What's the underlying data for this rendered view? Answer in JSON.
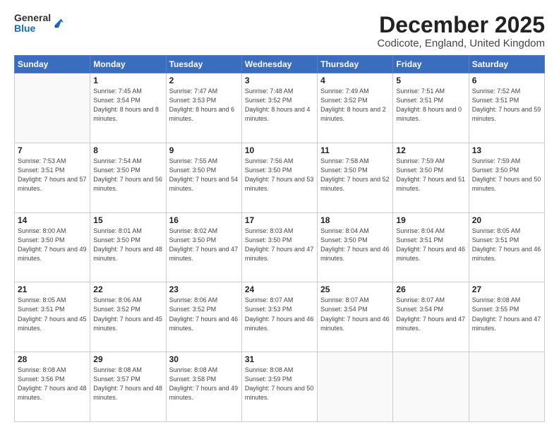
{
  "logo": {
    "general": "General",
    "blue": "Blue"
  },
  "title": "December 2025",
  "subtitle": "Codicote, England, United Kingdom",
  "days_header": [
    "Sunday",
    "Monday",
    "Tuesday",
    "Wednesday",
    "Thursday",
    "Friday",
    "Saturday"
  ],
  "weeks": [
    [
      {
        "day": "",
        "sunrise": "",
        "sunset": "",
        "daylight": ""
      },
      {
        "day": "1",
        "sunrise": "Sunrise: 7:45 AM",
        "sunset": "Sunset: 3:54 PM",
        "daylight": "Daylight: 8 hours and 8 minutes."
      },
      {
        "day": "2",
        "sunrise": "Sunrise: 7:47 AM",
        "sunset": "Sunset: 3:53 PM",
        "daylight": "Daylight: 8 hours and 6 minutes."
      },
      {
        "day": "3",
        "sunrise": "Sunrise: 7:48 AM",
        "sunset": "Sunset: 3:52 PM",
        "daylight": "Daylight: 8 hours and 4 minutes."
      },
      {
        "day": "4",
        "sunrise": "Sunrise: 7:49 AM",
        "sunset": "Sunset: 3:52 PM",
        "daylight": "Daylight: 8 hours and 2 minutes."
      },
      {
        "day": "5",
        "sunrise": "Sunrise: 7:51 AM",
        "sunset": "Sunset: 3:51 PM",
        "daylight": "Daylight: 8 hours and 0 minutes."
      },
      {
        "day": "6",
        "sunrise": "Sunrise: 7:52 AM",
        "sunset": "Sunset: 3:51 PM",
        "daylight": "Daylight: 7 hours and 59 minutes."
      }
    ],
    [
      {
        "day": "7",
        "sunrise": "Sunrise: 7:53 AM",
        "sunset": "Sunset: 3:51 PM",
        "daylight": "Daylight: 7 hours and 57 minutes."
      },
      {
        "day": "8",
        "sunrise": "Sunrise: 7:54 AM",
        "sunset": "Sunset: 3:50 PM",
        "daylight": "Daylight: 7 hours and 56 minutes."
      },
      {
        "day": "9",
        "sunrise": "Sunrise: 7:55 AM",
        "sunset": "Sunset: 3:50 PM",
        "daylight": "Daylight: 7 hours and 54 minutes."
      },
      {
        "day": "10",
        "sunrise": "Sunrise: 7:56 AM",
        "sunset": "Sunset: 3:50 PM",
        "daylight": "Daylight: 7 hours and 53 minutes."
      },
      {
        "day": "11",
        "sunrise": "Sunrise: 7:58 AM",
        "sunset": "Sunset: 3:50 PM",
        "daylight": "Daylight: 7 hours and 52 minutes."
      },
      {
        "day": "12",
        "sunrise": "Sunrise: 7:59 AM",
        "sunset": "Sunset: 3:50 PM",
        "daylight": "Daylight: 7 hours and 51 minutes."
      },
      {
        "day": "13",
        "sunrise": "Sunrise: 7:59 AM",
        "sunset": "Sunset: 3:50 PM",
        "daylight": "Daylight: 7 hours and 50 minutes."
      }
    ],
    [
      {
        "day": "14",
        "sunrise": "Sunrise: 8:00 AM",
        "sunset": "Sunset: 3:50 PM",
        "daylight": "Daylight: 7 hours and 49 minutes."
      },
      {
        "day": "15",
        "sunrise": "Sunrise: 8:01 AM",
        "sunset": "Sunset: 3:50 PM",
        "daylight": "Daylight: 7 hours and 48 minutes."
      },
      {
        "day": "16",
        "sunrise": "Sunrise: 8:02 AM",
        "sunset": "Sunset: 3:50 PM",
        "daylight": "Daylight: 7 hours and 47 minutes."
      },
      {
        "day": "17",
        "sunrise": "Sunrise: 8:03 AM",
        "sunset": "Sunset: 3:50 PM",
        "daylight": "Daylight: 7 hours and 47 minutes."
      },
      {
        "day": "18",
        "sunrise": "Sunrise: 8:04 AM",
        "sunset": "Sunset: 3:50 PM",
        "daylight": "Daylight: 7 hours and 46 minutes."
      },
      {
        "day": "19",
        "sunrise": "Sunrise: 8:04 AM",
        "sunset": "Sunset: 3:51 PM",
        "daylight": "Daylight: 7 hours and 46 minutes."
      },
      {
        "day": "20",
        "sunrise": "Sunrise: 8:05 AM",
        "sunset": "Sunset: 3:51 PM",
        "daylight": "Daylight: 7 hours and 46 minutes."
      }
    ],
    [
      {
        "day": "21",
        "sunrise": "Sunrise: 8:05 AM",
        "sunset": "Sunset: 3:51 PM",
        "daylight": "Daylight: 7 hours and 45 minutes."
      },
      {
        "day": "22",
        "sunrise": "Sunrise: 8:06 AM",
        "sunset": "Sunset: 3:52 PM",
        "daylight": "Daylight: 7 hours and 45 minutes."
      },
      {
        "day": "23",
        "sunrise": "Sunrise: 8:06 AM",
        "sunset": "Sunset: 3:52 PM",
        "daylight": "Daylight: 7 hours and 46 minutes."
      },
      {
        "day": "24",
        "sunrise": "Sunrise: 8:07 AM",
        "sunset": "Sunset: 3:53 PM",
        "daylight": "Daylight: 7 hours and 46 minutes."
      },
      {
        "day": "25",
        "sunrise": "Sunrise: 8:07 AM",
        "sunset": "Sunset: 3:54 PM",
        "daylight": "Daylight: 7 hours and 46 minutes."
      },
      {
        "day": "26",
        "sunrise": "Sunrise: 8:07 AM",
        "sunset": "Sunset: 3:54 PM",
        "daylight": "Daylight: 7 hours and 47 minutes."
      },
      {
        "day": "27",
        "sunrise": "Sunrise: 8:08 AM",
        "sunset": "Sunset: 3:55 PM",
        "daylight": "Daylight: 7 hours and 47 minutes."
      }
    ],
    [
      {
        "day": "28",
        "sunrise": "Sunrise: 8:08 AM",
        "sunset": "Sunset: 3:56 PM",
        "daylight": "Daylight: 7 hours and 48 minutes."
      },
      {
        "day": "29",
        "sunrise": "Sunrise: 8:08 AM",
        "sunset": "Sunset: 3:57 PM",
        "daylight": "Daylight: 7 hours and 48 minutes."
      },
      {
        "day": "30",
        "sunrise": "Sunrise: 8:08 AM",
        "sunset": "Sunset: 3:58 PM",
        "daylight": "Daylight: 7 hours and 49 minutes."
      },
      {
        "day": "31",
        "sunrise": "Sunrise: 8:08 AM",
        "sunset": "Sunset: 3:59 PM",
        "daylight": "Daylight: 7 hours and 50 minutes."
      },
      {
        "day": "",
        "sunrise": "",
        "sunset": "",
        "daylight": ""
      },
      {
        "day": "",
        "sunrise": "",
        "sunset": "",
        "daylight": ""
      },
      {
        "day": "",
        "sunrise": "",
        "sunset": "",
        "daylight": ""
      }
    ]
  ]
}
